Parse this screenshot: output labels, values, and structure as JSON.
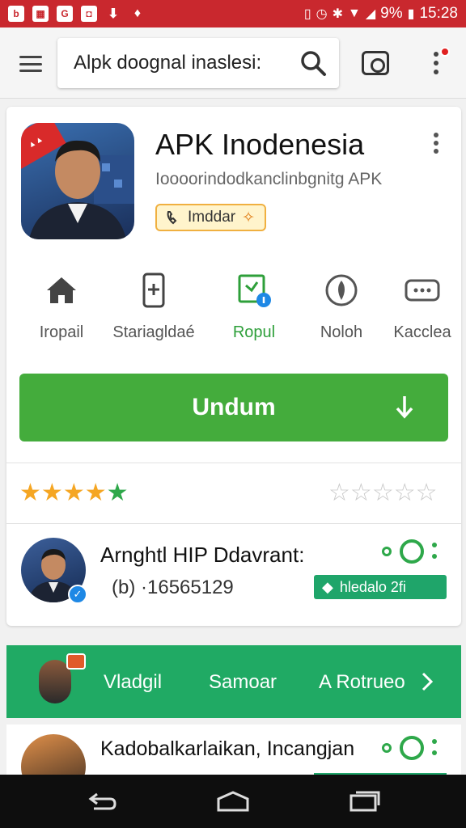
{
  "status_bar": {
    "left_icons": [
      "b",
      "image",
      "G",
      "chat",
      "download",
      "notification"
    ],
    "battery_text": "9%",
    "time": "15:28"
  },
  "search": {
    "query": "Alpk doognal inaslesi:"
  },
  "app": {
    "title": "APK Inodenesia",
    "subtitle": "Ioooorindodkanclinbgnitg APK",
    "chip_label": "Imddar"
  },
  "categories": [
    {
      "label": "Iropail",
      "icon": "home-icon"
    },
    {
      "label": "Stariagldaé",
      "icon": "phone-add-icon"
    },
    {
      "label": "Ropul",
      "icon": "download-folder-icon",
      "active": true
    },
    {
      "label": "Noloh",
      "icon": "leaf-icon"
    },
    {
      "label": "Kacclea",
      "icon": "ticket-icon"
    }
  ],
  "download_button": {
    "label": "Undum"
  },
  "rating": {
    "stars_filled": 5,
    "empty_stars": 5
  },
  "developer": {
    "name": "Arnghtl HIP Ddavrant:",
    "count": "(b) ·16565129",
    "tag_label": "hledalo 2fi"
  },
  "strip": {
    "items": [
      "Vladgil",
      "Samoar",
      "A Rotrueo"
    ]
  },
  "second_item": {
    "title": "Kadobalkarlaikan, Incangjan"
  },
  "colors": {
    "status_red": "#c9282e",
    "primary_green": "#44ac3c",
    "strip_green": "#20aa64",
    "star_orange": "#f5a623"
  }
}
